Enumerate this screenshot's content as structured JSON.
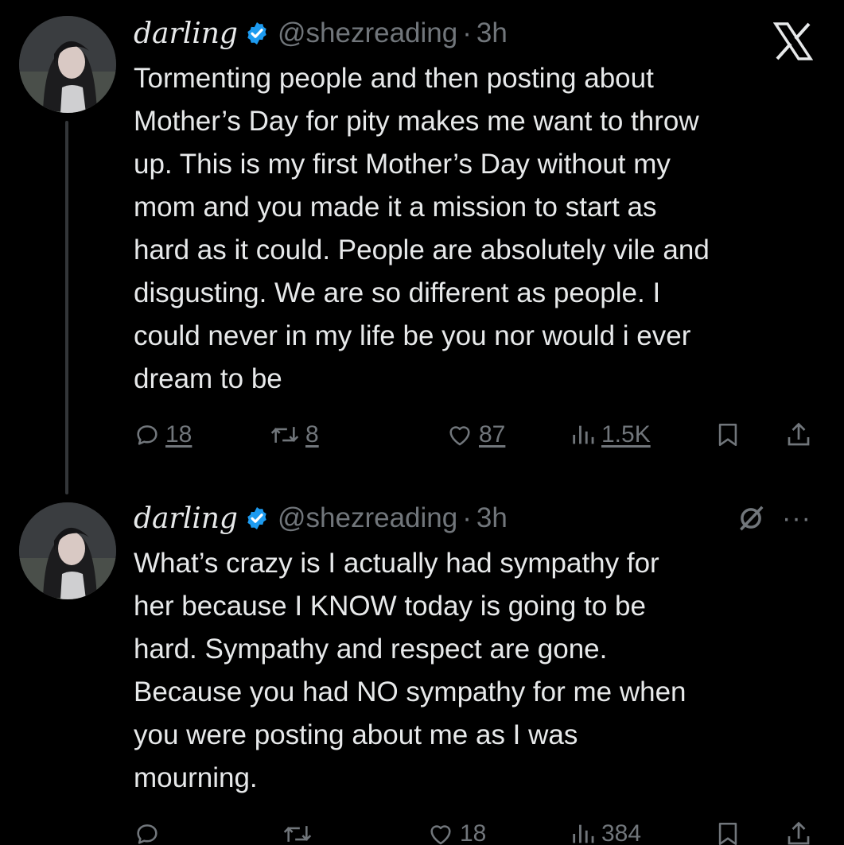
{
  "tweets": [
    {
      "display_name": "darling",
      "handle": "@shezreading",
      "separator": "·",
      "time": "3h",
      "text": "Tormenting people and then posting about\nMother’s Day for pity makes me want to throw\nup. This is my first Mother’s Day without my\nmom and you made it a mission to start as\nhard as it could. People are absolutely vile and\ndisgusting. We are so different as people. I\ncould never in my life be you nor would i ever\ndream to be",
      "replies": "18",
      "reposts": "8",
      "likes": "87",
      "views": "1.5K"
    },
    {
      "display_name": "darling",
      "handle": "@shezreading",
      "separator": "·",
      "time": "3h",
      "text": "What’s crazy is I actually had sympathy for\nher because I KNOW today is going to be\nhard. Sympathy and respect are gone.\nBecause you had NO sympathy for me when\nyou were posting about me as I was\nmourning.",
      "replies": "",
      "reposts": "",
      "likes": "18",
      "views": "384"
    }
  ],
  "more_label": "···",
  "icons": {
    "brand": "x-logo-icon",
    "verified": "verified-badge-icon",
    "reply": "reply-icon",
    "repost": "repost-icon",
    "like": "heart-icon",
    "views": "views-icon",
    "bookmark": "bookmark-icon",
    "share": "share-icon",
    "grok": "grok-icon",
    "more": "more-icon"
  },
  "colors": {
    "background": "#000000",
    "text": "#e7e9ea",
    "muted": "#71767b",
    "verified": "#1d9bf0",
    "thread_line": "#333639"
  }
}
